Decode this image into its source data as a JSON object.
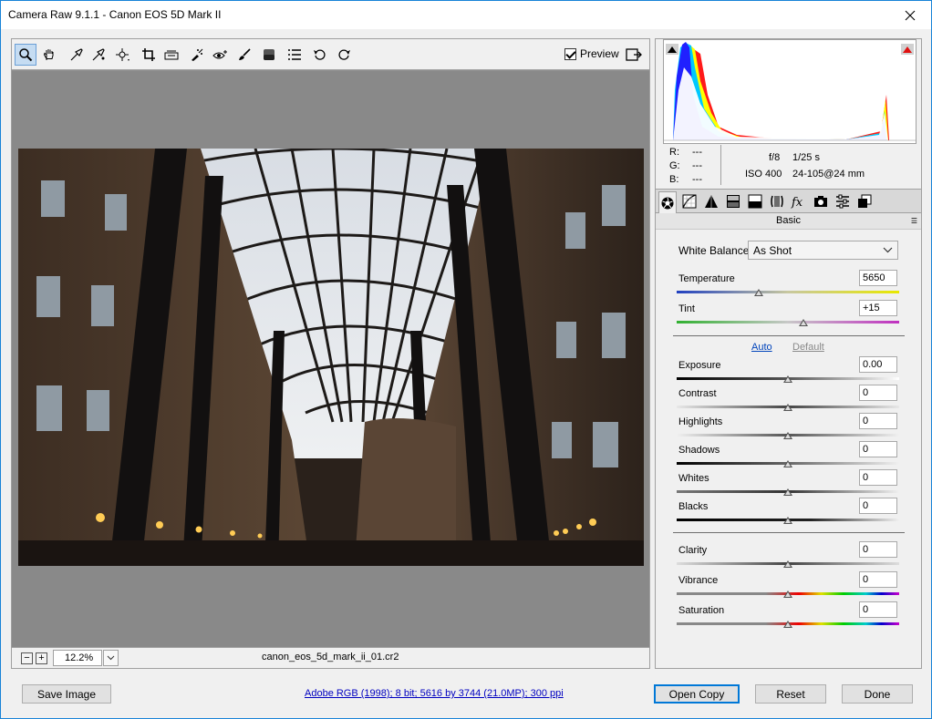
{
  "window": {
    "title": "Camera Raw 9.1.1  -  Canon EOS 5D Mark II"
  },
  "toolbar": {
    "tools": [
      "zoom-icon",
      "hand-icon",
      "white-balance-icon",
      "color-sampler-icon",
      "targeted-adjustment-icon",
      "crop-icon",
      "straighten-icon",
      "spot-removal-icon",
      "red-eye-icon",
      "adjustment-brush-icon",
      "graduated-filter-icon",
      "preferences-icon",
      "rotate-ccw-icon",
      "rotate-cw-icon"
    ],
    "preview_label": "Preview"
  },
  "status": {
    "zoom": "12.2%",
    "filename": "canon_eos_5d_mark_ii_01.cr2"
  },
  "info": {
    "r_label": "R:",
    "g_label": "G:",
    "b_label": "B:",
    "r_value": "---",
    "g_value": "---",
    "b_value": "---",
    "aperture": "f/8",
    "shutter": "1/25 s",
    "iso": "ISO 400",
    "lens": "24-105@24 mm"
  },
  "panel": {
    "title": "Basic",
    "white_balance_label": "White Balance:",
    "white_balance_value": "As Shot",
    "auto_label": "Auto",
    "default_label": "Default",
    "sliders": [
      {
        "key": "temperature",
        "label": "Temperature",
        "value": "5650",
        "level": 0.37
      },
      {
        "key": "tint",
        "label": "Tint",
        "value": "+15",
        "level": 0.57
      },
      {
        "key": "exposure",
        "label": "Exposure",
        "value": "0.00",
        "level": 0.5
      },
      {
        "key": "contrast",
        "label": "Contrast",
        "value": "0",
        "level": 0.5
      },
      {
        "key": "highlights",
        "label": "Highlights",
        "value": "0",
        "level": 0.5
      },
      {
        "key": "shadows",
        "label": "Shadows",
        "value": "0",
        "level": 0.5
      },
      {
        "key": "whites",
        "label": "Whites",
        "value": "0",
        "level": 0.5
      },
      {
        "key": "blacks",
        "label": "Blacks",
        "value": "0",
        "level": 0.5
      },
      {
        "key": "clarity",
        "label": "Clarity",
        "value": "0",
        "level": 0.5
      },
      {
        "key": "vibrance",
        "label": "Vibrance",
        "value": "0",
        "level": 0.5
      },
      {
        "key": "saturation",
        "label": "Saturation",
        "value": "0",
        "level": 0.5
      }
    ]
  },
  "footer": {
    "save_label": "Save Image",
    "workflow_link": "Adobe RGB (1998); 8 bit; 5616 by 3744 (21.0MP); 300 ppi",
    "open_label": "Open Copy",
    "reset_label": "Reset",
    "done_label": "Done"
  },
  "colors": {
    "accent": "#0078d7",
    "link": "#0000c0"
  }
}
